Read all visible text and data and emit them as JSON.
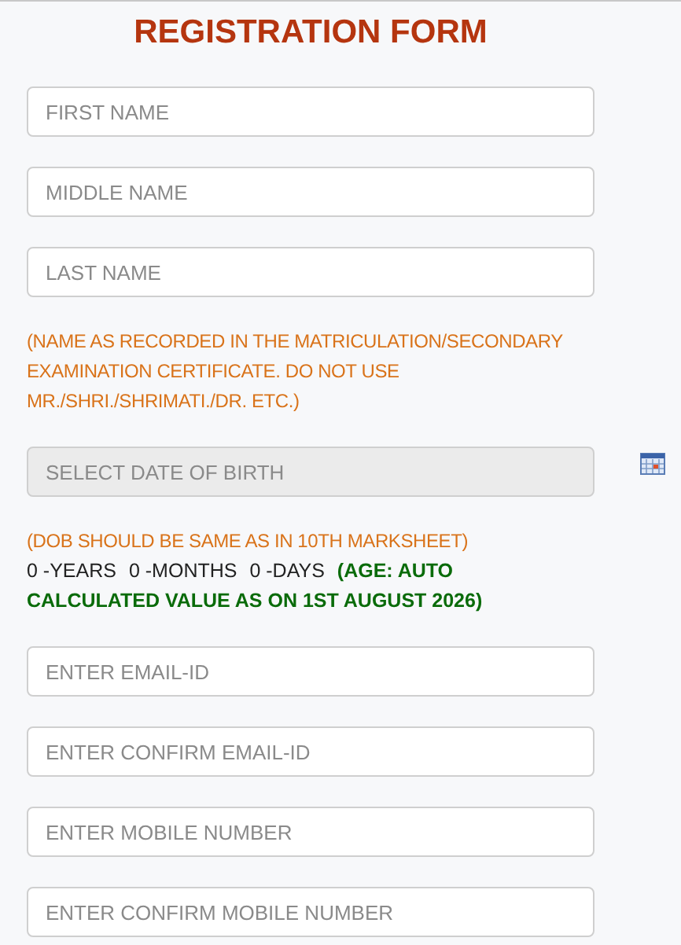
{
  "title": "REGISTRATION FORM",
  "name_fields": [
    {
      "placeholder": "FIRST NAME",
      "disabled": false
    },
    {
      "placeholder": "MIDDLE NAME",
      "disabled": false
    },
    {
      "placeholder": "LAST NAME",
      "disabled": false
    }
  ],
  "name_note": "(NAME AS RECORDED IN THE MATRICULATION/SECONDARY EXAMINATION CERTIFICATE. DO NOT USE MR./SHRI./SHRIMATI./DR. ETC.)",
  "dob_field": {
    "placeholder": "SELECT DATE OF BIRTH",
    "disabled": true
  },
  "dob_note": "(DOB SHOULD BE SAME AS IN 10TH MARKSHEET)",
  "age": {
    "years": "0 -YEARS",
    "months": "0 -MONTHS",
    "days": "0 -DAYS",
    "note": "(AGE: AUTO CALCULATED VALUE AS ON 1ST AUGUST 2026)"
  },
  "contact_fields": [
    {
      "placeholder": "ENTER EMAIL-ID",
      "disabled": false
    },
    {
      "placeholder": "ENTER CONFIRM EMAIL-ID",
      "disabled": false
    },
    {
      "placeholder": "ENTER MOBILE NUMBER",
      "disabled": false
    },
    {
      "placeholder": "ENTER CONFIRM MOBILE NUMBER",
      "disabled": false
    }
  ]
}
